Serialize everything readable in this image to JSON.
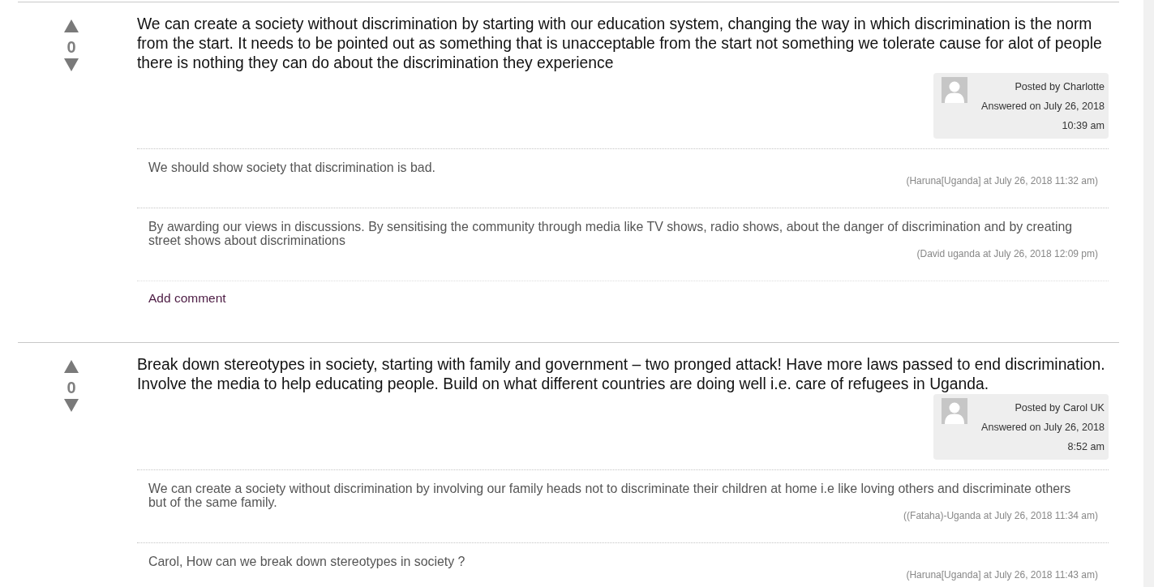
{
  "answers": [
    {
      "votes": "0",
      "text": "We can create a society without discrimination by starting with our education system, changing the way in which discrimination is the norm from the start. It needs to be pointed out as something that is unacceptable from the start not something we tolerate cause for alot of people there is nothing they can do about the discrimination they experience",
      "author": {
        "posted_by": "Posted by Charlotte",
        "answered_on": "Answered on July 26, 2018",
        "time": "10:39 am"
      },
      "comments": [
        {
          "text": "We should show society that discrimination is bad.",
          "meta": "(Haruna[Uganda] at July 26, 2018 11:32 am)"
        },
        {
          "text": "By awarding our views in discussions. By sensitising the community through media like TV shows, radio shows, about the danger of discrimination and by creating street shows about discriminations",
          "meta": "(David uganda at July 26, 2018 12:09 pm)"
        }
      ],
      "add_comment": "Add comment"
    },
    {
      "votes": "0",
      "text": "Break down stereotypes in society, starting with family and government – two pronged attack! Have more laws passed to end discrimination. Involve the media to help educating people. Build on what different countries are doing well i.e. care of refugees in Uganda.",
      "author": {
        "posted_by": "Posted by Carol UK",
        "answered_on": "Answered on July 26, 2018",
        "time": "8:52 am"
      },
      "comments": [
        {
          "text": "We can create a society without discrimination by involving our family heads not to discriminate their children at home i.e like loving others and discriminate others but of the same family.",
          "meta": "((Fataha)-Uganda at July 26, 2018 11:34 am)"
        },
        {
          "text": "Carol, How can we break down stereotypes in society ?",
          "meta": "(Haruna[Uganda] at July 26, 2018 11:43 am)"
        }
      ]
    }
  ]
}
